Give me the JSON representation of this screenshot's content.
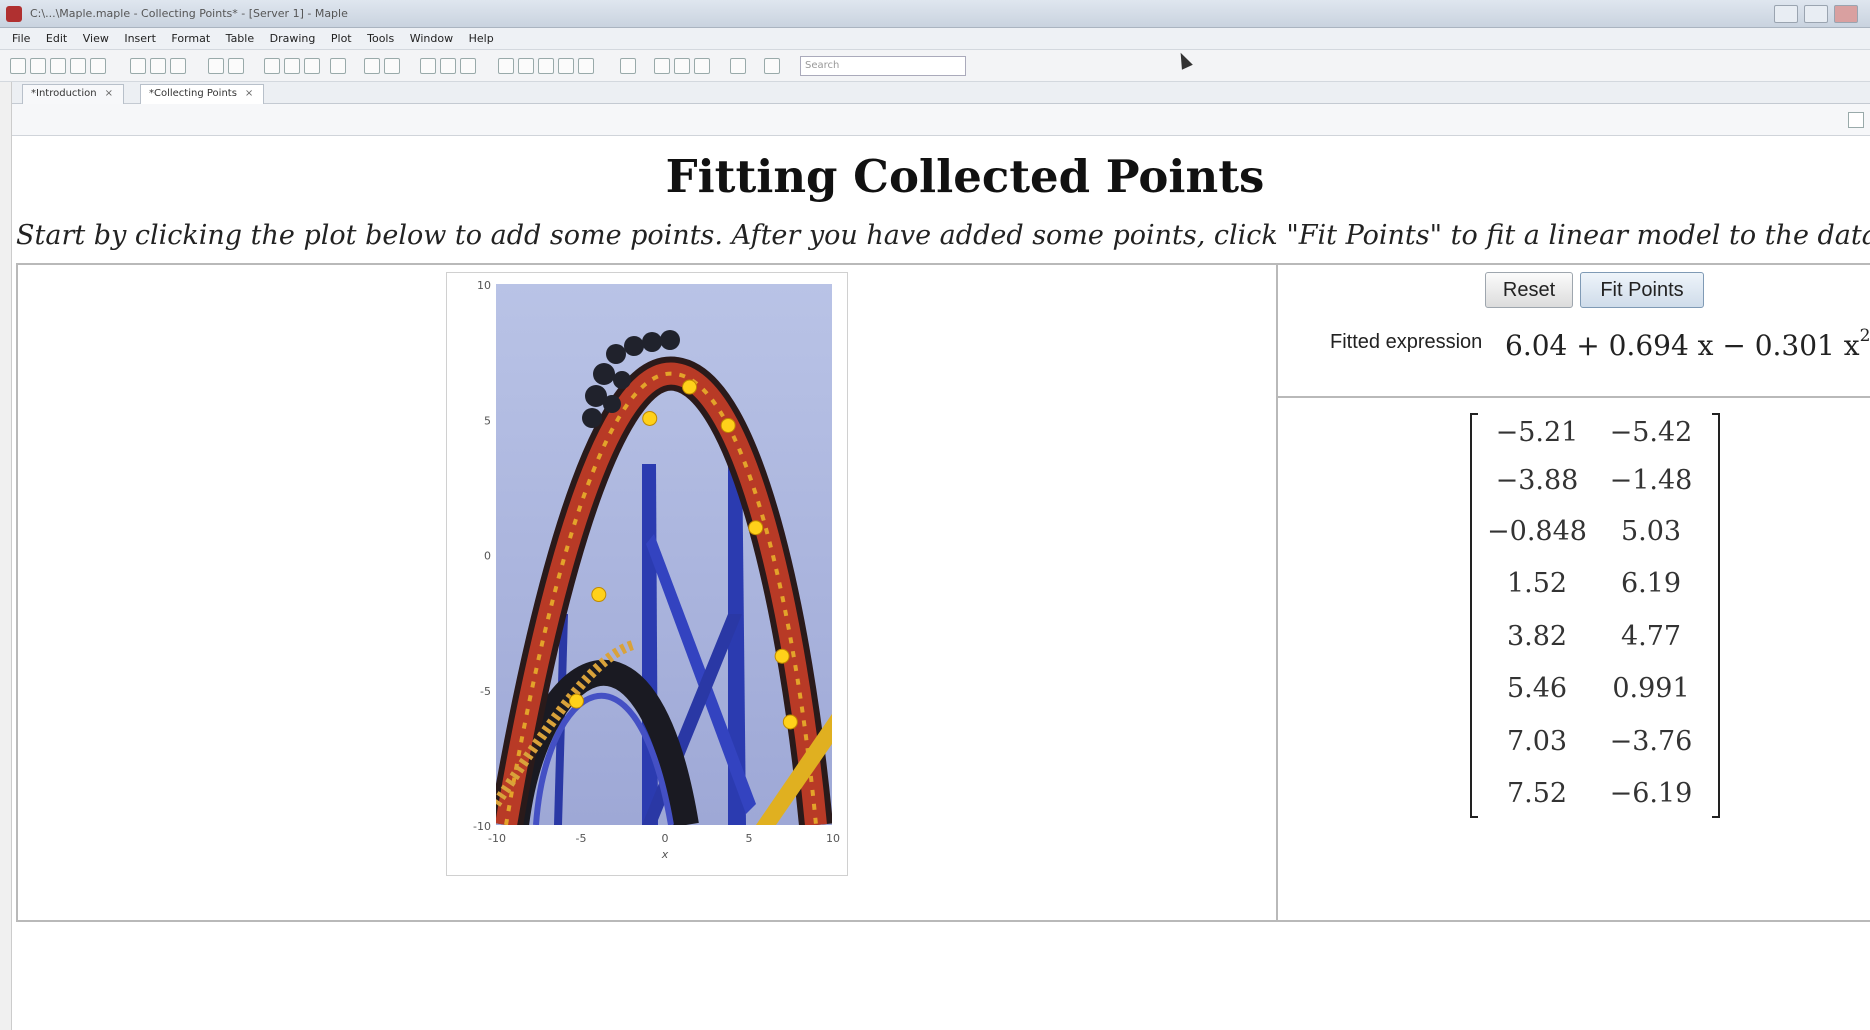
{
  "window": {
    "title": "C:\\...\\Maple.maple - Collecting Points* - [Server 1] - Maple"
  },
  "menu": [
    "File",
    "Edit",
    "View",
    "Insert",
    "Format",
    "Table",
    "Drawing",
    "Plot",
    "Tools",
    "Window",
    "Help"
  ],
  "toolbar": {
    "search_placeholder": "Search"
  },
  "tabs": [
    {
      "label": "*Introduction",
      "close": "×"
    },
    {
      "label": "*Collecting Points",
      "close": "×"
    }
  ],
  "document": {
    "title": "Fitting Collected Points",
    "instructions": "Start by clicking the plot below to add some points. After you have added some points, click \"Fit Points\" to fit a linear model to the data."
  },
  "buttons": {
    "reset": "Reset",
    "fit_points": "Fit Points"
  },
  "fit": {
    "label": "Fitted expression",
    "expression_main": "6.04 + 0.694 x − 0.301 x",
    "exponent": "2"
  },
  "matrix": [
    [
      "−5.21",
      "−5.42"
    ],
    [
      "−3.88",
      "−1.48"
    ],
    [
      "−0.848",
      "5.03"
    ],
    [
      "1.52",
      "6.19"
    ],
    [
      "3.82",
      "4.77"
    ],
    [
      "5.46",
      "0.991"
    ],
    [
      "7.03",
      "−3.76"
    ],
    [
      "7.52",
      "−6.19"
    ]
  ],
  "chart_data": {
    "type": "scatter",
    "x": [
      -5.21,
      -3.88,
      -0.848,
      1.52,
      3.82,
      5.46,
      7.03,
      7.52
    ],
    "y": [
      -5.42,
      -1.48,
      5.03,
      6.19,
      4.77,
      0.991,
      -3.76,
      -6.19
    ],
    "xlim": [
      -10,
      10
    ],
    "ylim": [
      -10,
      10
    ],
    "x_ticks": [
      "-10",
      "-5",
      "0",
      "5",
      "10"
    ],
    "y_ticks": [
      "10",
      "5",
      "0",
      "-5",
      "-10"
    ],
    "xlabel": "x",
    "point_color": "#ffd11a",
    "background_image": "roller-coaster-photo"
  }
}
